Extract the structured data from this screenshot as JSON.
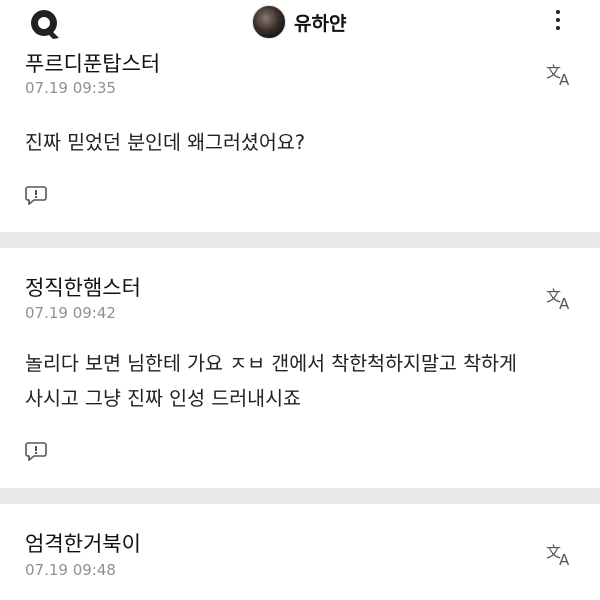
{
  "header": {
    "title": "유하얀",
    "logo_icon": "q-logo-icon",
    "menu_icon": "kebab-menu-icon"
  },
  "comments": [
    {
      "author": "푸르디푼탑스터",
      "time": "07.19 09:35",
      "body_lines": [
        "진짜 믿었던 분인데 왜그러셨어요?"
      ]
    },
    {
      "author": "정직한햄스터",
      "time": "07.19 09:42",
      "body_lines": [
        "놀리다 보면 님한테 가요 ㅈㅂ 갠에서 착한척하지말고 착하게",
        "사시고 그냥 진짜 인성 드러내시죠"
      ]
    },
    {
      "author": "엄격한거북이",
      "time": "07.19 09:48",
      "body_lines": []
    }
  ],
  "colors": {
    "divider": "#e9e9eb",
    "time": "#8e9197",
    "icon": "#555555"
  }
}
